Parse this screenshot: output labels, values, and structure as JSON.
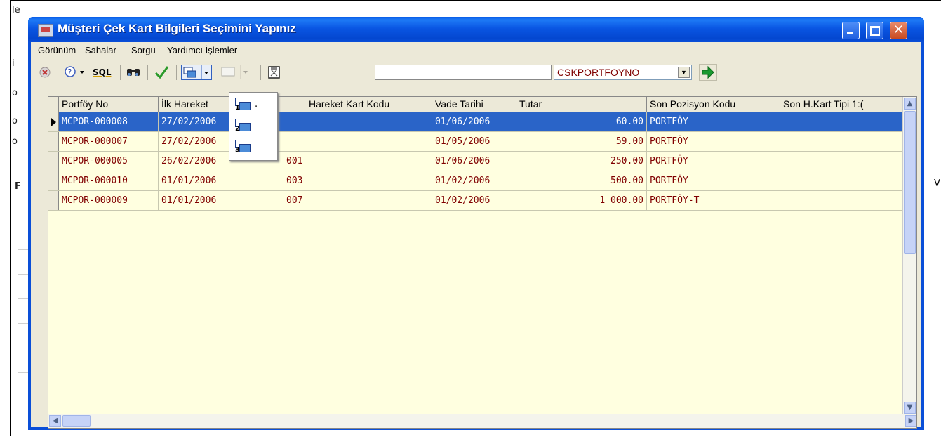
{
  "background": {
    "letters": [
      "le",
      "i",
      "o",
      "o",
      "o",
      "F"
    ],
    "right_letter": "V"
  },
  "window": {
    "title": "Müşteri Çek Kart Bilgileri Seçimini Yapınız",
    "controls": {
      "close": "✕"
    }
  },
  "menu": {
    "items": [
      "Görünüm",
      "Sahalar",
      "Sorgu",
      "Yardımcı İşlemler"
    ]
  },
  "toolbar": {
    "sql_label": "SQL",
    "search_value": "",
    "field_combo_value": "CSKPORTFOYNO"
  },
  "grid": {
    "columns": [
      "Portföy No",
      "İlk Hareket",
      "Hareket Kart Kodu",
      "Vade Tarihi",
      "Tutar",
      "Son Pozisyon Kodu",
      "Son H.Kart Tipi 1:("
    ],
    "rows": [
      [
        "MCPOR-000008",
        "27/02/2006",
        "",
        "01/06/2006",
        "60.00",
        "PORTFÖY",
        ""
      ],
      [
        "MCPOR-000007",
        "27/02/2006",
        "",
        "01/05/2006",
        "59.00",
        "PORTFÖY",
        ""
      ],
      [
        "MCPOR-000005",
        "26/02/2006",
        "001",
        "01/06/2006",
        "250.00",
        "PORTFÖY",
        ""
      ],
      [
        "MCPOR-000010",
        "01/01/2006",
        "003",
        "01/02/2006",
        "500.00",
        "PORTFÖY",
        ""
      ],
      [
        "MCPOR-000009",
        "01/01/2006",
        "007",
        "01/02/2006",
        "1 000.00",
        "PORTFÖY-T",
        ""
      ]
    ],
    "selected_row": 0
  },
  "popup_menu": {
    "items": [
      {
        "number": "1",
        "label": "."
      },
      {
        "number": "2",
        "label": ""
      },
      {
        "number": "3",
        "label": ""
      }
    ]
  }
}
